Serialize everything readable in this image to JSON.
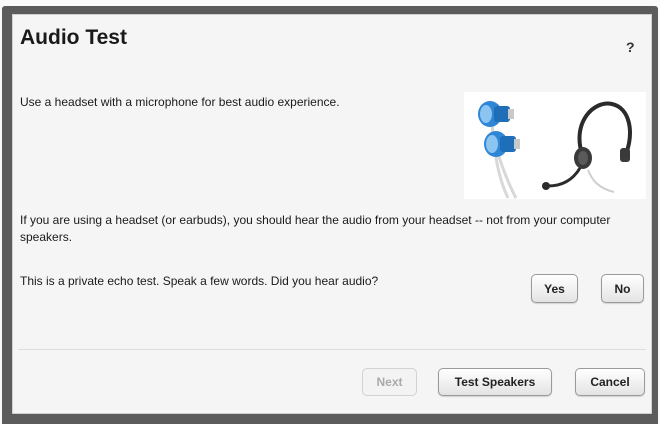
{
  "dialog": {
    "title": "Audio Test",
    "help_label": "?",
    "instruction": "Use a headset with a microphone for best audio experience.",
    "headset_note": "If you are using a headset (or earbuds), you should hear the audio from your headset -- not from your computer speakers.",
    "echo_prompt": "This is a private echo test.  Speak a few words.  Did you hear audio?",
    "yes_label": "Yes",
    "no_label": "No",
    "next_label": "Next",
    "test_speakers_label": "Test Speakers",
    "cancel_label": "Cancel",
    "illustration_icons": [
      "earbuds-icon",
      "headset-icon"
    ]
  },
  "colors": {
    "frame": "#5c5c5c",
    "dialog_bg": "#f5f5f5",
    "earbud_blue": "#2f86d6"
  }
}
